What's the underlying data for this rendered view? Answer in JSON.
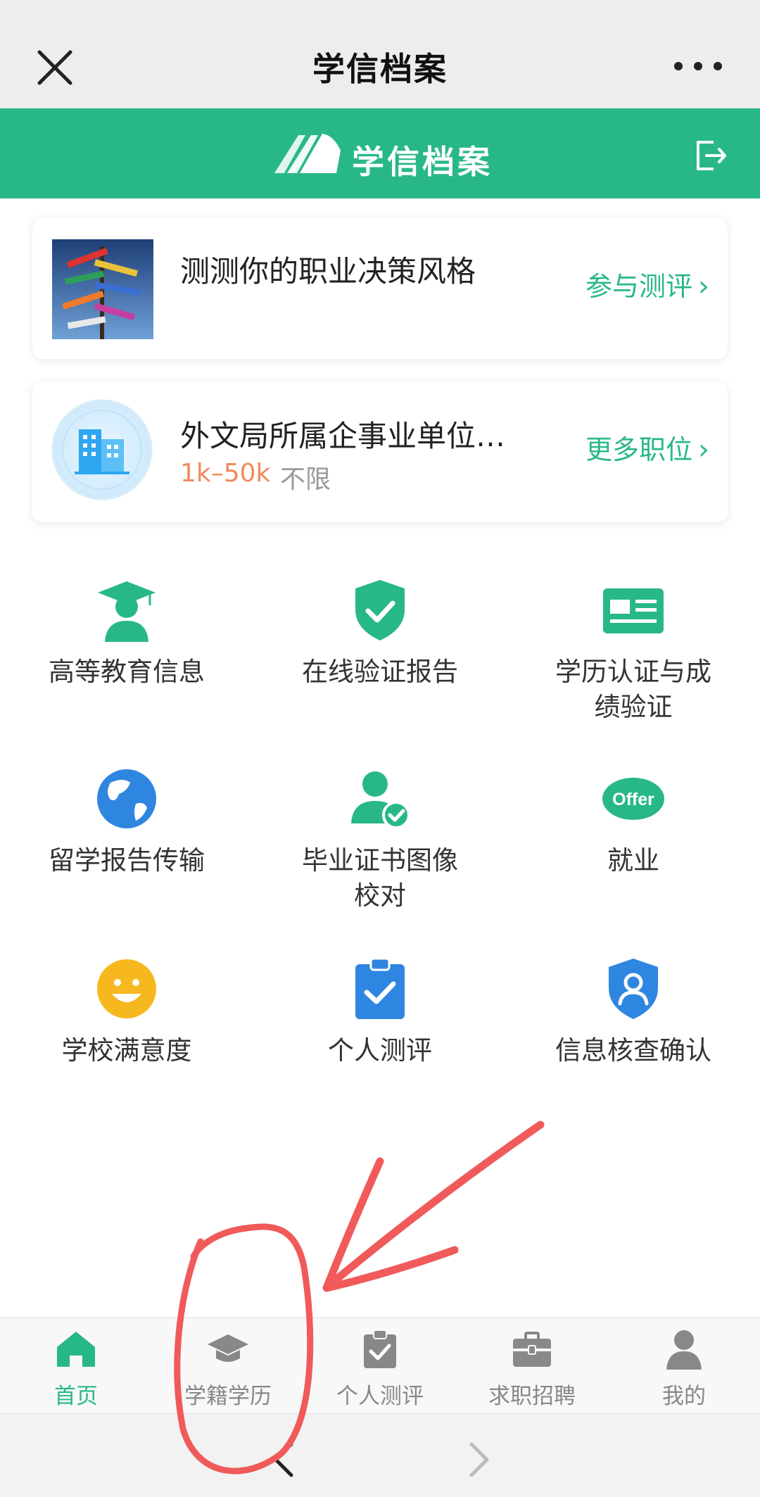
{
  "wechat_bar": {
    "title": "学信档案"
  },
  "header": {
    "logo_text": "学信档案"
  },
  "cards": [
    {
      "title": "测测你的职业决策风格",
      "link_label": "参与测评",
      "chevron": "›"
    },
    {
      "title": "外文局所属企事业单位…",
      "salary": "1k–50k",
      "education": "不限",
      "link_label": "更多职位",
      "chevron": "›"
    }
  ],
  "grid": [
    {
      "label": "高等教育信息",
      "icon": "graduate-icon",
      "color": "#28b887"
    },
    {
      "label": "在线验证报告",
      "icon": "shield-check-icon",
      "color": "#28b887"
    },
    {
      "label": "学历认证与成\n绩验证",
      "icon": "id-card-icon",
      "color": "#28b887"
    },
    {
      "label": "留学报告传输",
      "icon": "globe-icon",
      "color": "#2f86e0"
    },
    {
      "label": "毕业证书图像\n校对",
      "icon": "user-check-icon",
      "color": "#28b887"
    },
    {
      "label": "就业",
      "icon": "offer-icon",
      "color": "#28b887",
      "badge": "Offer"
    },
    {
      "label": "学校满意度",
      "icon": "smile-icon",
      "color": "#f7b81f"
    },
    {
      "label": "个人测评",
      "icon": "clipboard-check-icon",
      "color": "#2f86e0"
    },
    {
      "label": "信息核查确认",
      "icon": "shield-user-icon",
      "color": "#2f86e0"
    }
  ],
  "bottom_nav": [
    {
      "label": "首页",
      "icon": "home-icon",
      "active": true
    },
    {
      "label": "学籍学历",
      "icon": "mortarboard-icon",
      "active": false
    },
    {
      "label": "个人测评",
      "icon": "clipboard-check-icon",
      "active": false
    },
    {
      "label": "求职招聘",
      "icon": "briefcase-icon",
      "active": false
    },
    {
      "label": "我的",
      "icon": "person-icon",
      "active": false
    }
  ],
  "colors": {
    "brand": "#28b887",
    "salary": "#f08a5d",
    "annotation": "#f05a5a"
  }
}
